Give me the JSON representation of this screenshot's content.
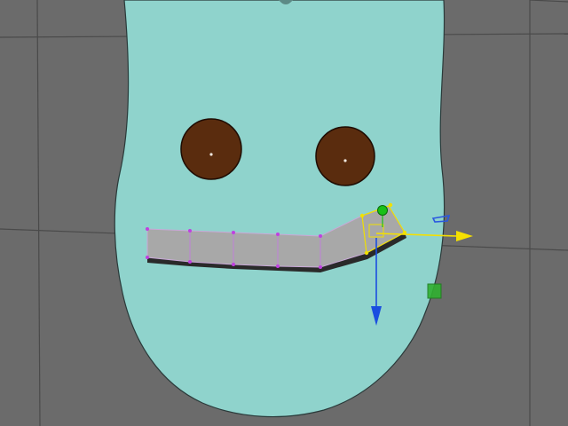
{
  "colors": {
    "background": "#6b6b6b",
    "grid_line": "#4a4a4a",
    "body_fill": "#8fd3cc",
    "body_edge": "#2a3a3a",
    "eye_fill": "#5a2c0e",
    "mouth_fill": "#a8a8a8",
    "mouth_edge": "#2a2a2a",
    "mouth_vertex": "#c040e0",
    "selected_vertex": "#f0e000",
    "gizmo_x": "#f5e000",
    "gizmo_y": "#1a4ee0",
    "gizmo_center": "#18c018",
    "gizmo_plane_green": "#30b030",
    "gizmo_plane_blue": "#2a58e0"
  },
  "icons": {
    "move_tool_gizmo": "move-manipulator-icon",
    "x_axis_handle": "x-axis-arrow-icon",
    "y_axis_handle": "y-axis-arrow-icon",
    "center_handle": "center-handle-icon",
    "yz_plane_handle": "yz-plane-handle-icon",
    "xy_plane_handle": "xy-plane-handle-icon"
  }
}
